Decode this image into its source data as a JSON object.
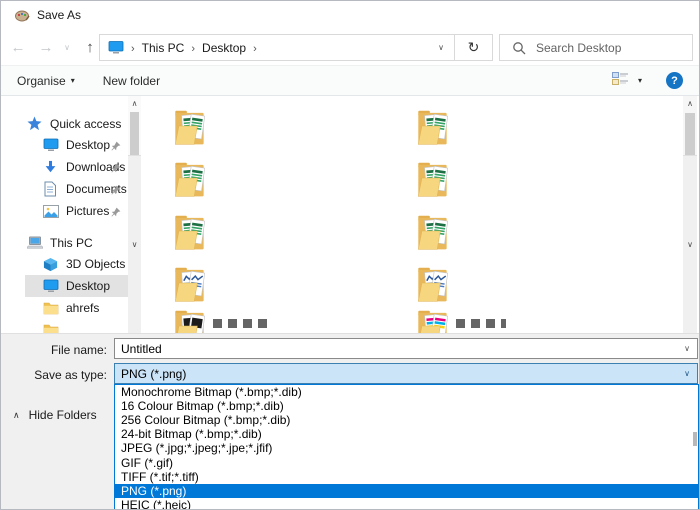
{
  "window": {
    "title": "Save As"
  },
  "glyphs": {
    "back": "←",
    "forward": "→",
    "up": "↑",
    "refresh": "↻",
    "chevron_down": "∨",
    "chevron_up": "∧",
    "caret_down": "▾",
    "crumb_sep": "›",
    "help": "?"
  },
  "nav": {
    "breadcrumb": {
      "root_icon": "desktop-icon",
      "items": [
        "This PC",
        "Desktop"
      ]
    },
    "search": {
      "placeholder": "Search Desktop",
      "icon": "search-icon"
    }
  },
  "toolbar": {
    "organise_label": "Organise",
    "new_folder_label": "New folder",
    "view_icon": "view-options-icon",
    "help_icon": "help-icon"
  },
  "sidebar": {
    "groups": [
      {
        "label": "Quick access",
        "icon": "star-icon",
        "items": [
          {
            "label": "Desktop",
            "icon": "monitor-icon",
            "pinned": true
          },
          {
            "label": "Downloads",
            "icon": "download-icon",
            "pinned": true
          },
          {
            "label": "Documents",
            "icon": "document-icon",
            "pinned": true
          },
          {
            "label": "Pictures",
            "icon": "picture-icon",
            "pinned": true
          }
        ]
      },
      {
        "label": "This PC",
        "icon": "computer-icon",
        "items": [
          {
            "label": "3D Objects",
            "icon": "cube-icon"
          },
          {
            "label": "Desktop",
            "icon": "monitor-icon",
            "selected": true
          },
          {
            "label": "ahrefs",
            "icon": "folder-icon"
          },
          {
            "label": "",
            "icon": "folder-icon",
            "clipped": true
          }
        ]
      }
    ]
  },
  "filegrid": {
    "items": [
      {
        "col": 0,
        "row": 0,
        "variant": "green"
      },
      {
        "col": 1,
        "row": 0,
        "variant": "green"
      },
      {
        "col": 0,
        "row": 1,
        "variant": "green"
      },
      {
        "col": 1,
        "row": 1,
        "variant": "green"
      },
      {
        "col": 0,
        "row": 2,
        "variant": "green"
      },
      {
        "col": 1,
        "row": 2,
        "variant": "green"
      },
      {
        "col": 0,
        "row": 3,
        "variant": "blue"
      },
      {
        "col": 1,
        "row": 3,
        "variant": "blue"
      },
      {
        "col": 0,
        "row": 4,
        "variant": "dark",
        "clipped": true,
        "name_sliver": true
      },
      {
        "col": 1,
        "row": 4,
        "variant": "rainbow",
        "clipped": true,
        "name_sliver": true
      }
    ]
  },
  "fields": {
    "file_name_label": "File name:",
    "file_name_value": "Untitled",
    "save_type_label": "Save as type:",
    "save_type_value": "PNG (*.png)"
  },
  "dropdown": {
    "options": [
      "Monochrome Bitmap (*.bmp;*.dib)",
      "16 Colour Bitmap (*.bmp;*.dib)",
      "256 Colour Bitmap (*.bmp;*.dib)",
      "24-bit Bitmap (*.bmp;*.dib)",
      "JPEG (*.jpg;*.jpeg;*.jpe;*.jfif)",
      "GIF (*.gif)",
      "TIFF (*.tif;*.tiff)",
      "PNG (*.png)",
      "HEIC (*.heic)"
    ],
    "selected_index": 7
  },
  "footer": {
    "hide_folders_label": "Hide Folders"
  },
  "colors": {
    "accent": "#0078d7",
    "combo_focus_fill": "#cce4f7",
    "combo_focus_border": "#3c7fb1",
    "selection_text": "#ffffff",
    "folder_yellow": "#e9b85a",
    "help_blue": "#1574c4",
    "bottom_bar": "#f0f0f0"
  }
}
